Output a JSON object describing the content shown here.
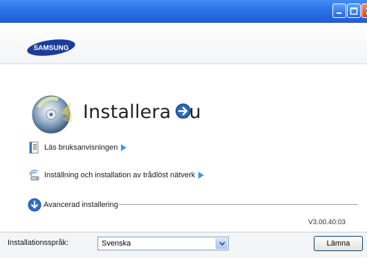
{
  "window": {
    "controls": {
      "minimize_icon": "minimize-icon",
      "maximize_icon": "maximize-icon",
      "close_icon": "close-icon"
    }
  },
  "header": {
    "logo_text": "SAMSUNG"
  },
  "main": {
    "install_now": "Installera nu",
    "links": [
      {
        "label": "Läs bruksanvisningen",
        "icon": "manual-icon"
      },
      {
        "label": "Inställning och installation av trådlöst nätverk",
        "icon": "wireless-icon"
      }
    ],
    "advanced": {
      "label": "Avancerad installering",
      "icon": "down-arrow-icon"
    },
    "version": "V3.00.40:03"
  },
  "footer": {
    "language_label": "Installationsspråk:",
    "language_value": "Svenska",
    "leave_button": "Lämna"
  },
  "colors": {
    "titlebar": "#2a72e6",
    "accent_arrow": "#3b9be7",
    "logo_blue": "#1b3c9a"
  }
}
